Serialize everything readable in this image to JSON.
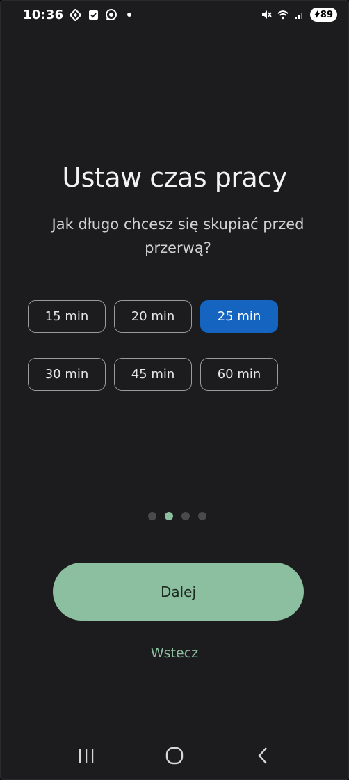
{
  "status_bar": {
    "time": "10:36",
    "battery": "89"
  },
  "screen": {
    "title": "Ustaw czas pracy",
    "subtitle": "Jak długo chcesz się skupiać przed przerwą?"
  },
  "options": [
    {
      "label": "15 min",
      "selected": false
    },
    {
      "label": "20 min",
      "selected": false
    },
    {
      "label": "25 min",
      "selected": true
    },
    {
      "label": "30 min",
      "selected": false
    },
    {
      "label": "45 min",
      "selected": false
    },
    {
      "label": "60 min",
      "selected": false
    }
  ],
  "pager": {
    "count": 4,
    "active_index": 1
  },
  "actions": {
    "next_label": "Dalej",
    "back_label": "Wstecz"
  },
  "colors": {
    "background": "#1c1c1e",
    "accent_green": "#8cbfa0",
    "selected_blue": "#1565c0"
  }
}
